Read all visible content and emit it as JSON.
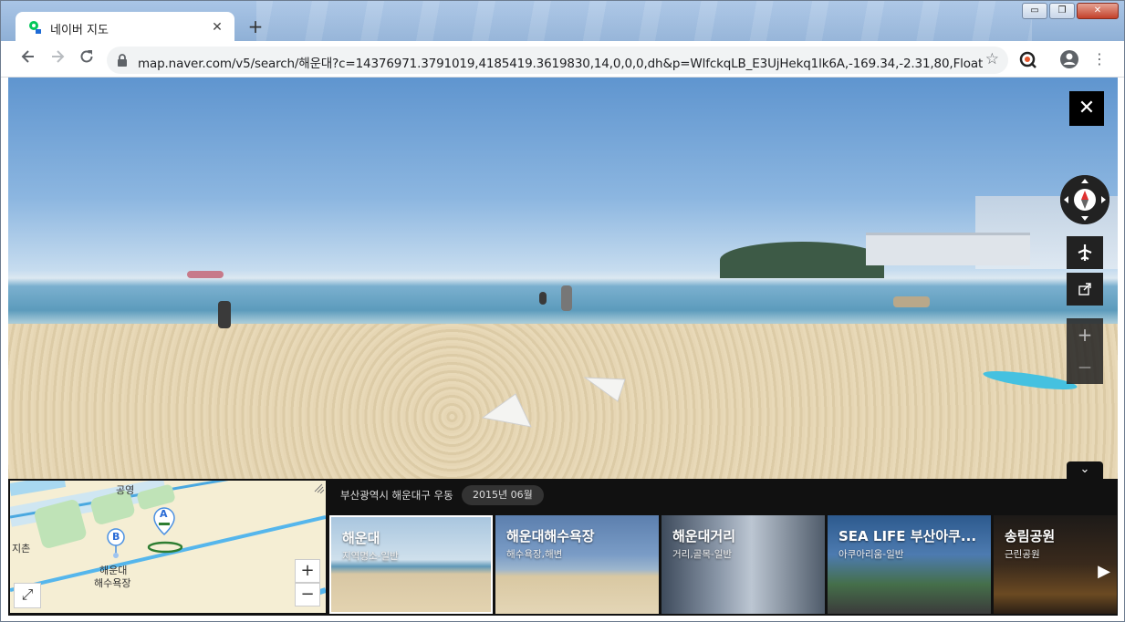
{
  "browser": {
    "tab_title": "네이버 지도",
    "tab_close": "✕",
    "new_tab": "+",
    "url": "map.naver.com/v5/search/해운대?c=14376971.3791019,4185419.3619830,14,0,0,0,dh&p=WlfckqLB_E3UjHekq1lk6A,-169.34,-2.31,80,Float",
    "window_controls": {
      "minimize": "▭",
      "maximize": "❐",
      "close": "✕"
    }
  },
  "streetview": {
    "close_label": "✕",
    "zoom_in": "+",
    "zoom_out": "—",
    "collapse": "⌄",
    "icons": {
      "aerial": "airplane-icon",
      "share": "share-icon",
      "compass": "compass-icon"
    }
  },
  "panel": {
    "location": "부산광역시 해운대구 우동",
    "date": "2015년 06월",
    "next": "▶",
    "cards": [
      {
        "name": "해운대",
        "category": "지역명소-일반"
      },
      {
        "name": "해운대해수욕장",
        "category": "해수욕장,해변"
      },
      {
        "name": "해운대거리",
        "category": "거리,골목-일반"
      },
      {
        "name": "SEA LIFE 부산아쿠...",
        "category": "아쿠아리움-일반"
      },
      {
        "name": "송림공원",
        "category": "근린공원"
      }
    ]
  },
  "minimap": {
    "labels": {
      "gongyeong": "공영",
      "jichon": "지촌",
      "beach_line1": "해운대",
      "beach_line2": "해수욕장",
      "marker_a": "A",
      "marker_b": "B"
    },
    "zoom_in": "+",
    "zoom_out": "−",
    "expand": "⤢"
  }
}
